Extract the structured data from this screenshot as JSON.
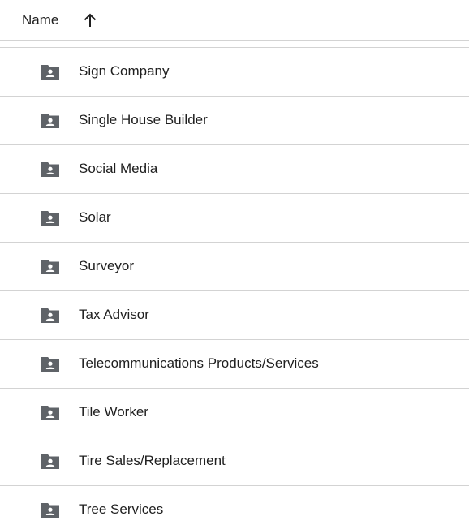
{
  "header": {
    "name_label": "Name",
    "sort_icon": "arrow-up-icon"
  },
  "folder_icon": "shared-folder-icon",
  "folder_color": "#5f6368",
  "items": [
    {
      "label": "Sign Company"
    },
    {
      "label": "Single House Builder"
    },
    {
      "label": "Social Media"
    },
    {
      "label": "Solar"
    },
    {
      "label": "Surveyor"
    },
    {
      "label": "Tax Advisor"
    },
    {
      "label": "Telecommunications Products/Services"
    },
    {
      "label": "Tile Worker"
    },
    {
      "label": "Tire Sales/Replacement"
    },
    {
      "label": "Tree Services"
    }
  ]
}
